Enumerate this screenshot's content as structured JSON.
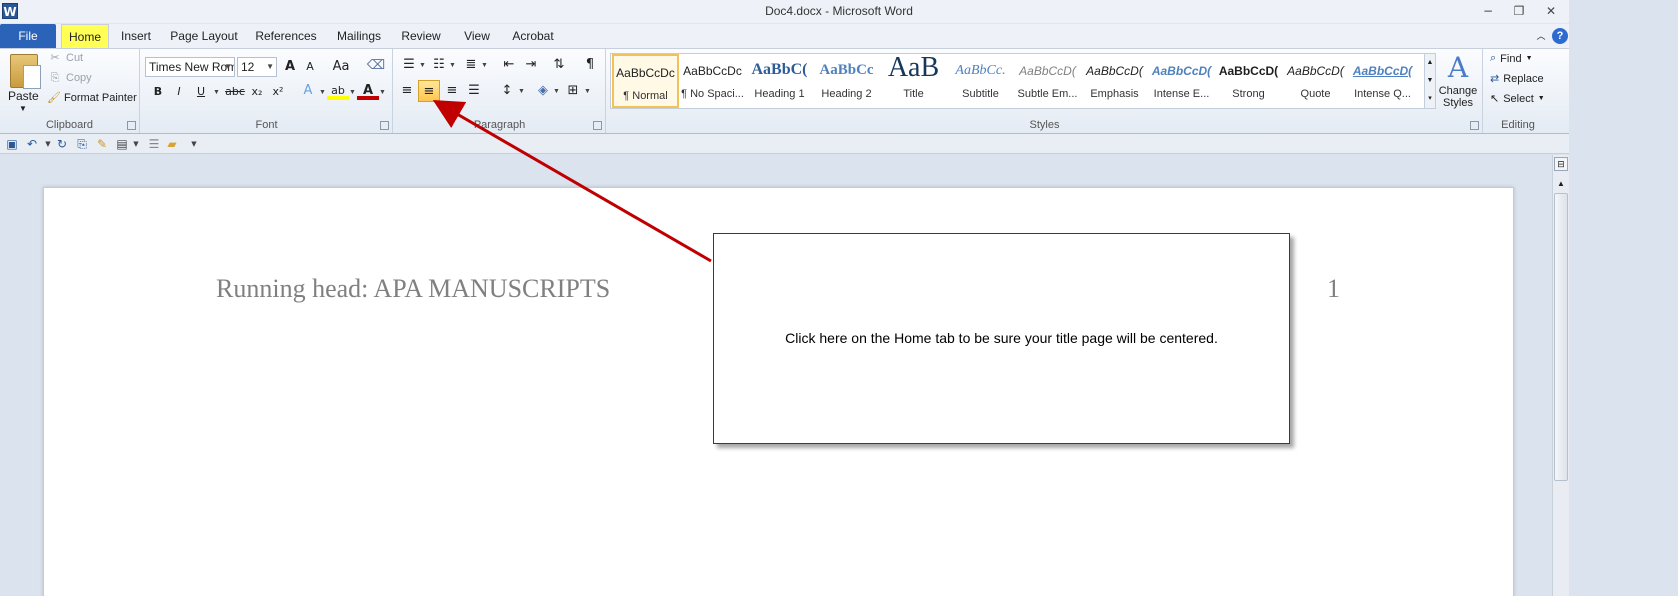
{
  "window": {
    "app_icon": "W",
    "title": "Doc4.docx - Microsoft Word",
    "minimize": "−",
    "restore": "❐",
    "close": "✕"
  },
  "tabs": [
    {
      "label": "File"
    },
    {
      "label": "Home"
    },
    {
      "label": "Insert"
    },
    {
      "label": "Page Layout"
    },
    {
      "label": "References"
    },
    {
      "label": "Mailings"
    },
    {
      "label": "Review"
    },
    {
      "label": "View"
    },
    {
      "label": "Acrobat"
    }
  ],
  "ribbon": {
    "clipboard": {
      "paste": "Paste",
      "cut": "Cut",
      "copy": "Copy",
      "format_painter": "Format Painter",
      "label": "Clipboard"
    },
    "font": {
      "name": "Times New Rom",
      "size": "12",
      "label": "Font",
      "grow": "A",
      "shrink": "A",
      "change_case": "Aa",
      "bold": "B",
      "italic": "I",
      "underline": "U",
      "strike": "abc",
      "subscript": "x₂",
      "superscript": "x²",
      "text_effects": "A",
      "highlight": "ab",
      "font_color": "A"
    },
    "paragraph": {
      "label": "Paragraph",
      "pilcrow": "¶"
    },
    "styles": {
      "label": "Styles",
      "items": [
        {
          "sample": "AaBbCcDc",
          "name": "¶ Normal"
        },
        {
          "sample": "AaBbCcDc",
          "name": "¶ No Spaci..."
        },
        {
          "sample": "AaBbC(",
          "name": "Heading 1"
        },
        {
          "sample": "AaBbCc",
          "name": "Heading 2"
        },
        {
          "sample": "AaB",
          "name": "Title"
        },
        {
          "sample": "AaBbCc.",
          "name": "Subtitle"
        },
        {
          "sample": "AaBbCcD(",
          "name": "Subtle Em..."
        },
        {
          "sample": "AaBbCcD(",
          "name": "Emphasis"
        },
        {
          "sample": "AaBbCcD(",
          "name": "Intense E..."
        },
        {
          "sample": "AaBbCcD(",
          "name": "Strong"
        },
        {
          "sample": "AaBbCcD(",
          "name": "Quote"
        },
        {
          "sample": "AaBbCcD(",
          "name": "Intense Q..."
        }
      ],
      "change_styles": "Change Styles"
    },
    "editing": {
      "label": "Editing",
      "find": "Find",
      "replace": "Replace",
      "select": "Select"
    }
  },
  "document": {
    "running_head": "Running head: APA MANUSCRIPTS",
    "page_number": "1"
  },
  "callout": {
    "text": "Click here on the Home tab to be sure your title page will be centered."
  },
  "colors": {
    "arrow": "#c00000",
    "home_tab_highlight": "#ffff55",
    "file_tab": "#2a63b8"
  }
}
